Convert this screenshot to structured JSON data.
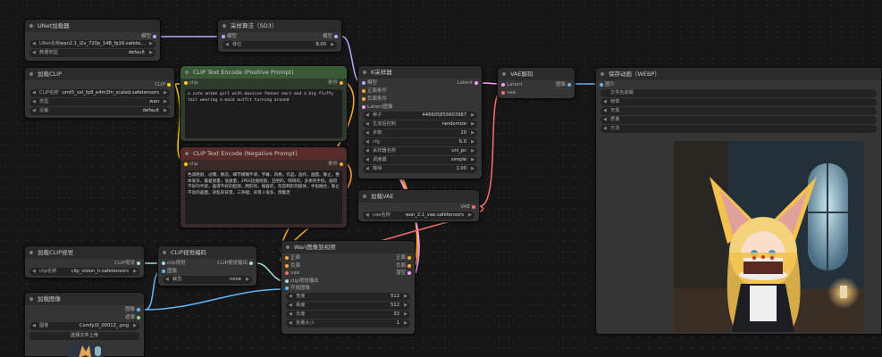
{
  "nodes": {
    "unet": {
      "title": "UNet加载器",
      "widgets": [
        {
          "label": "UNet名称",
          "value": "wan2.1_i2v_720p_14B_fp16.safete..."
        },
        {
          "label": "数据类型",
          "value": "default"
        }
      ],
      "outputs": [
        "模型"
      ]
    },
    "sampling": {
      "title": "采样算法（SD3）",
      "inputs": [
        "模型"
      ],
      "outputs": [
        "模型"
      ],
      "widgets": [
        {
          "label": "移位",
          "value": "8.00"
        }
      ]
    },
    "clip_loader": {
      "title": "加载CLIP",
      "outputs": [
        "CLIP"
      ],
      "widgets": [
        {
          "label": "CLIP名称",
          "value": "umt5_xxl_fp8_e4m3fn_scaled.safetensors"
        },
        {
          "label": "类型",
          "value": "wan"
        },
        {
          "label": "设备",
          "value": "default"
        }
      ]
    },
    "pos": {
      "title": "CLIP Text Encode (Positive Prompt)",
      "inputs": [
        "clip"
      ],
      "outputs": [
        "条件"
      ],
      "text": "a cute anime girl with massive fennec ears and a big fluffy tail wearing a maid outfit turning around"
    },
    "neg": {
      "title": "CLIP Text Encode (Negative Prompt)",
      "inputs": [
        "clip"
      ],
      "outputs": [
        "条件"
      ],
      "text": "色调艳丽，过曝，静态，细节模糊不清，字幕，风格，作品，画作，画面，静止，整体发灰，最差质量，低质量，JPEG压缩残留，丑陋的，残缺的，多余的手指，画得不好的手部，画得不好的脸部，畸形的，毁容的，形态畸形的肢体，手指融合，静止不动的画面，杂乱的背景，三条腿，背景人很多，倒着走"
    },
    "ksampler": {
      "title": "K采样器",
      "inputs": [
        "模型",
        "正面条件",
        "负面条件",
        "Latent图像"
      ],
      "outputs": [
        "Latent"
      ],
      "widgets": [
        {
          "label": "种子",
          "value": "446605855603987"
        },
        {
          "label": "生成后控制",
          "value": "randomize"
        },
        {
          "label": "步数",
          "value": "20"
        },
        {
          "label": "cfg",
          "value": "6.0"
        },
        {
          "label": "采样器名称",
          "value": "uni_pc"
        },
        {
          "label": "调度器",
          "value": "simple"
        },
        {
          "label": "降噪",
          "value": "1.00"
        }
      ]
    },
    "vae_decode": {
      "title": "VAE解码",
      "inputs": [
        "Latent",
        "vae"
      ],
      "outputs": [
        "图像"
      ]
    },
    "save": {
      "title": "保存动画（WEBP）",
      "inputs": [
        "图片"
      ],
      "widgets": [
        {
          "label": "文件名前缀",
          "value": ""
        },
        {
          "label": "帧率",
          "value": ""
        },
        {
          "label": "无损",
          "value": ""
        },
        {
          "label": "质量",
          "value": ""
        },
        {
          "label": "方法",
          "value": ""
        }
      ]
    },
    "vae_loader": {
      "title": "加载VAE",
      "outputs": [
        "VAE"
      ],
      "widgets": [
        {
          "label": "vae名称",
          "value": "wan_2.1_vae.safetensors"
        }
      ]
    },
    "wan": {
      "title": "Wan图像到视频",
      "inputs": [
        "正面",
        "负面",
        "vae",
        "clip视觉输出",
        "开始图像"
      ],
      "outputs": [
        "正面",
        "负面",
        "潜空"
      ],
      "widgets": [
        {
          "label": "宽度",
          "value": "512"
        },
        {
          "label": "高度",
          "value": "512"
        },
        {
          "label": "长度",
          "value": "33"
        },
        {
          "label": "批量大小",
          "value": "1"
        }
      ]
    },
    "clipvision_loader": {
      "title": "加载CLIP视觉",
      "outputs": [
        "CLIP视觉"
      ],
      "widgets": [
        {
          "label": "clip名称",
          "value": "clip_vision_h.safetensors"
        }
      ]
    },
    "clipvision_encode": {
      "title": "CLIP视觉编码",
      "inputs": [
        "clip视觉",
        "图像"
      ],
      "outputs": [
        "CLIP视觉输出"
      ],
      "widgets": [
        {
          "label": "裁剪",
          "value": "none"
        }
      ]
    },
    "load_image": {
      "title": "加载图像",
      "outputs": [
        "图像",
        "遮罩"
      ],
      "widgets": [
        {
          "label": "图像",
          "value": "ComfyUI_00012_.png"
        }
      ],
      "button": "选择文件上传"
    }
  },
  "colors": {
    "model_wire": "#b9a9ff",
    "clip_wire": "#ffd500",
    "cond_wire": "#ffa931",
    "latent_wire": "#ff9cf9",
    "vae_wire": "#ff6e6e",
    "image_wire": "#64b5f6",
    "clipvision_wire": "#a8dadc"
  }
}
